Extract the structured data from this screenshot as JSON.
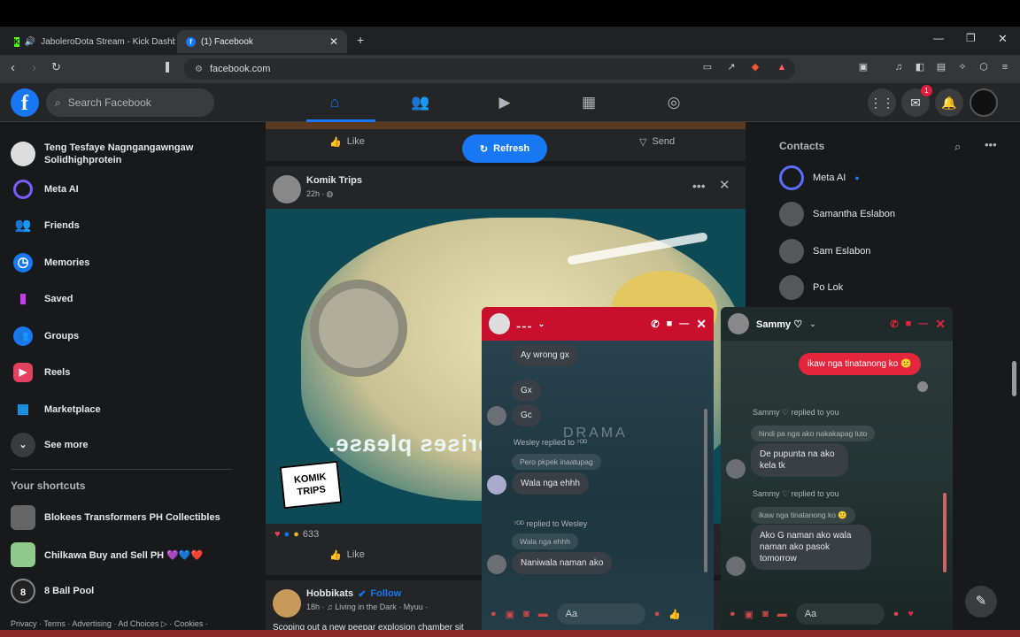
{
  "browser": {
    "tabs": [
      {
        "title": "JaboleroDota Stream - Kick Dashb",
        "icon": "kick-icon"
      },
      {
        "title": "(1) Facebook",
        "icon": "facebook-icon"
      }
    ],
    "url": "facebook.com"
  },
  "header": {
    "search_placeholder": "Search Facebook",
    "messenger_badge": "1"
  },
  "left_nav": {
    "profile_name": "Teng Tesfaye Nagngangawngaw Solidhighprotein",
    "items": [
      {
        "label": "Meta AI",
        "icon": "meta-ai-icon"
      },
      {
        "label": "Friends",
        "icon": "friends-icon"
      },
      {
        "label": "Memories",
        "icon": "memories-icon"
      },
      {
        "label": "Saved",
        "icon": "saved-icon"
      },
      {
        "label": "Groups",
        "icon": "groups-icon"
      },
      {
        "label": "Reels",
        "icon": "reels-icon"
      },
      {
        "label": "Marketplace",
        "icon": "marketplace-icon"
      },
      {
        "label": "See more",
        "icon": "chevron-down-icon"
      }
    ],
    "shortcuts_title": "Your shortcuts",
    "shortcuts": [
      {
        "label": "Blokees Transformers PH Collectibles"
      },
      {
        "label": "Chilkawa Buy and Sell PH 💜💙❤️"
      },
      {
        "label": "8 Ball Pool"
      }
    ],
    "footer": "Privacy · Terms · Advertising · Ad Choices ▷ · Cookies ·"
  },
  "feed": {
    "top_actions": {
      "like": "Like",
      "send": "Send"
    },
    "refresh_label": "Refresh",
    "post": {
      "author": "Komik Trips",
      "time": "22h · ",
      "image_text": "surprises please.",
      "logo_text": "KOMIK\nTRIPS",
      "reactions_count": "633",
      "like": "Like"
    },
    "next_post": {
      "author": "Hobbikats",
      "follow": "Follow",
      "meta": "18h · ♫ Living in the Dark · Myuu · ",
      "text": "Scoping out a new peepar explosion chamber sit"
    }
  },
  "contacts": {
    "title": "Contacts",
    "items": [
      {
        "name": "Meta AI"
      },
      {
        "name": "Samantha Eslabon"
      },
      {
        "name": "Sam Eslabon"
      },
      {
        "name": "Po Lok"
      }
    ]
  },
  "chat1": {
    "title": "ـ ـ ـ",
    "messages": {
      "m1": "Ay wrong gx",
      "m2": "Gx",
      "m3": "Gc",
      "reply1": "Wesley replied to ⁷ᴼᴰ",
      "quote1": "Pero pkpek inaatupag",
      "m4": "Wala nga ehhh",
      "reply2": "⁷ᴼᴰ replied to Wesley",
      "quote2": "Wala nga ehhh",
      "m5": "Naniwala naman ako"
    },
    "input_placeholder": "Aa",
    "watermark": "DRAMA"
  },
  "chat2": {
    "title": "Sammy ♡",
    "messages": {
      "sent1": "ikaw nga tinatanong ko 😕",
      "reply1": "Sammy ♡ replied to you",
      "quote1": "hindi pa nga ako nakakapag luto",
      "m1": "De pupunta na ako kela tk",
      "reply2": "Sammy ♡ replied to you",
      "quote2": "ikaw nga tinatanong ko 😕",
      "m2": "Ako G naman ako wala naman ako pasok tomorrow"
    },
    "input_placeholder": "Aa"
  },
  "colors": {
    "fb_blue": "#1877f2",
    "chat1_header": "#c8102e",
    "sent_bubble": "#e4263d"
  }
}
